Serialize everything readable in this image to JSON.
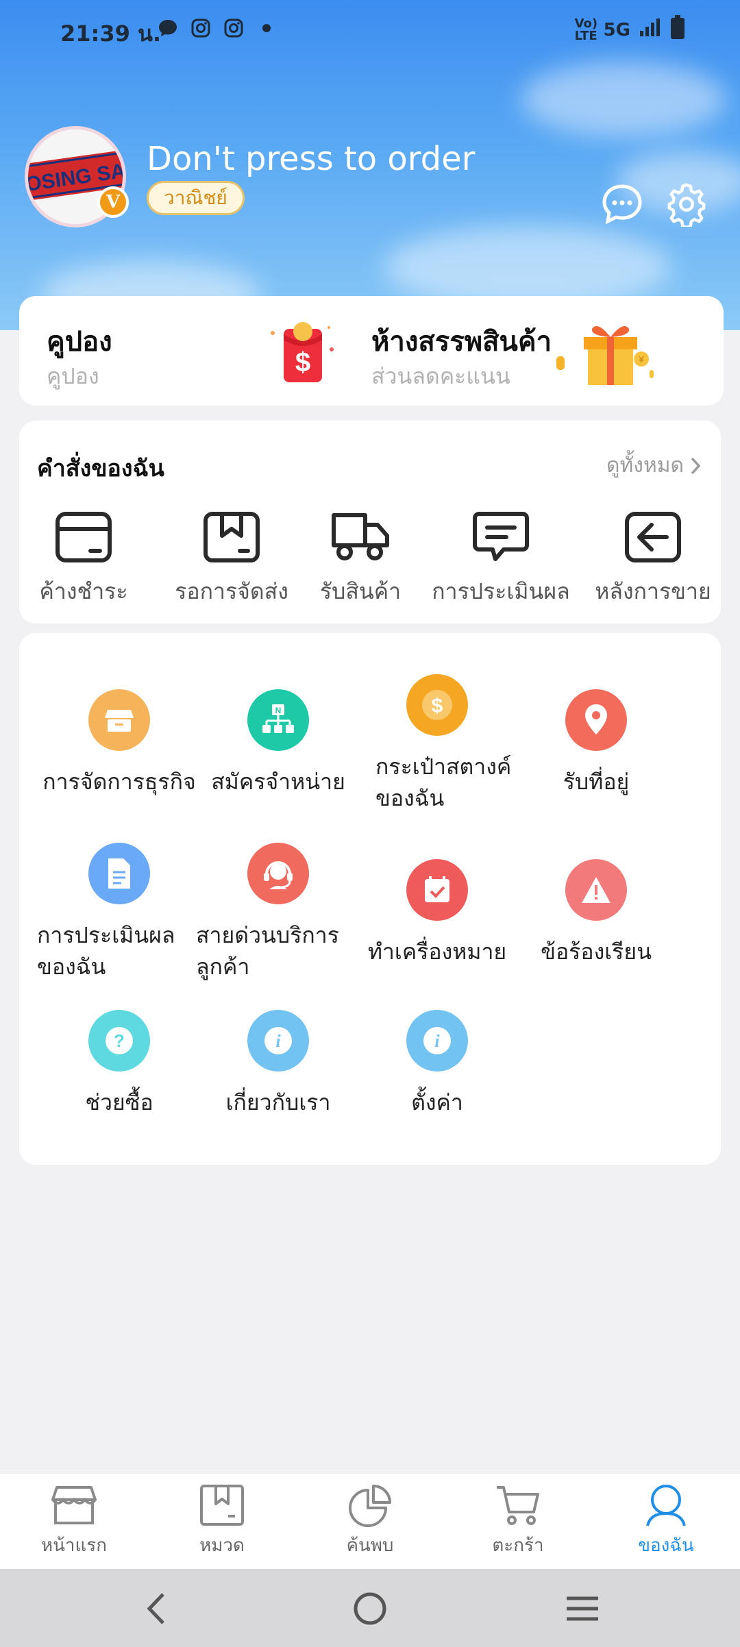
{
  "status_bar": {
    "time": "21:39 น.",
    "network": "5G",
    "volte": "Vo) LTE"
  },
  "profile": {
    "avatar_text": "OSING SA",
    "badge": "V",
    "name": "Don't press to order",
    "tag": "วาณิชย์"
  },
  "promo": {
    "coupon_title": "คูปอง",
    "coupon_sub": "คูปอง",
    "mall_title": "ห้างสรรพสินค้า",
    "mall_sub": "ส่วนลดคะแนน"
  },
  "orders": {
    "title": "คำสั่งของฉัน",
    "view_all": "ดูทั้งหมด",
    "items": [
      {
        "label": "ค้างชำระ",
        "icon": "wallet-icon"
      },
      {
        "label": "รอการจัดส่ง",
        "icon": "box-icon"
      },
      {
        "label": "รับสินค้า",
        "icon": "truck-icon"
      },
      {
        "label": "การประเมินผล",
        "icon": "comment-icon"
      },
      {
        "label": "หลังการขาย",
        "icon": "return-icon"
      }
    ]
  },
  "services": [
    {
      "label": "การจัดการธุรกิจ",
      "icon": "store-icon",
      "color": "#f6b45a"
    },
    {
      "label": "สมัครจำหน่าย",
      "icon": "network-icon",
      "color": "#1ec9a7"
    },
    {
      "label_lines": [
        "กระเป๋าสตางค์",
        "ของฉัน"
      ],
      "icon": "coin-icon",
      "color": "#f5a623"
    },
    {
      "label": "รับที่อยู่",
      "icon": "location-icon",
      "color": "#f26b5b"
    },
    {
      "label_lines": [
        "การประเมินผล",
        "ของฉัน"
      ],
      "icon": "document-icon",
      "color": "#6aa9f5"
    },
    {
      "label_lines": [
        "สายด่วนบริการ",
        "ลูกค้า"
      ],
      "icon": "headset-icon",
      "color": "#f06a5e"
    },
    {
      "label": "ทำเครื่องหมาย",
      "icon": "calendar-check-icon",
      "color": "#ef5b5b"
    },
    {
      "label": "ข้อร้องเรียน",
      "icon": "warning-icon",
      "color": "#f27a7a"
    },
    {
      "label": "ช่วยซื้อ",
      "icon": "question-icon",
      "color": "#5fd9e0"
    },
    {
      "label": "เกี่ยวกับเรา",
      "icon": "info-icon",
      "color": "#72c3f2"
    },
    {
      "label": "ตั้งค่า",
      "icon": "info-icon",
      "color": "#72c3f2"
    }
  ],
  "bottom_nav": [
    {
      "label": "หน้าแรก",
      "icon": "shop-icon"
    },
    {
      "label": "หมวด",
      "icon": "category-icon"
    },
    {
      "label": "ค้นพบ",
      "icon": "pie-chart-icon"
    },
    {
      "label": "ตะกร้า",
      "icon": "cart-icon"
    },
    {
      "label": "ของฉัน",
      "icon": "user-icon",
      "active": true
    }
  ],
  "colors": {
    "accent": "#1e8ee6",
    "header_top": "#3b8df0",
    "tag_text": "#d28b12"
  }
}
